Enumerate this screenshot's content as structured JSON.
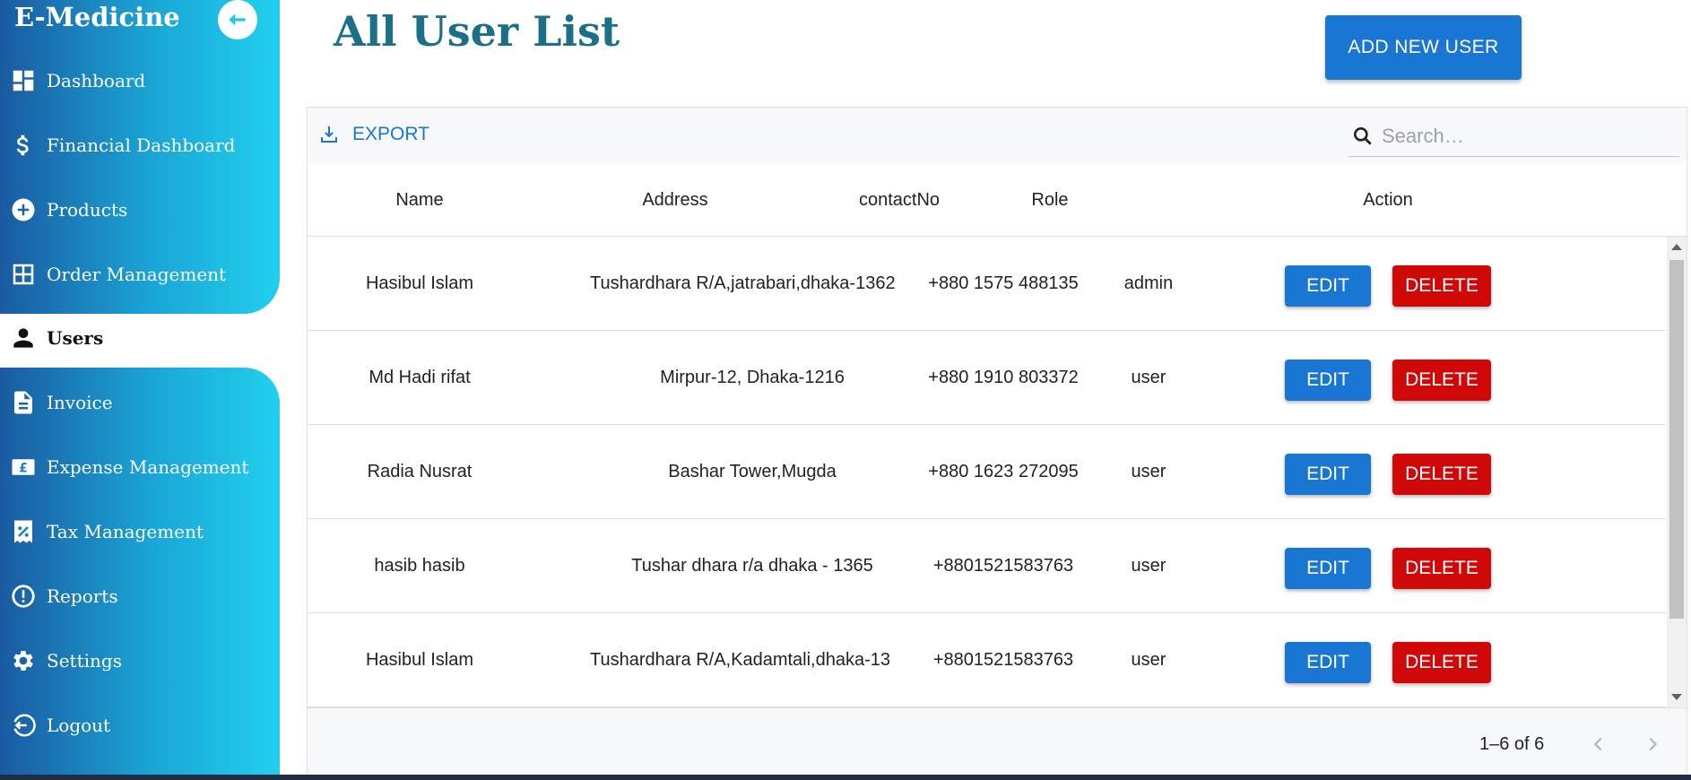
{
  "app": {
    "brand": "E-Medicine"
  },
  "sidebar": {
    "items": [
      {
        "label": "Dashboard",
        "icon": "dashboard-icon"
      },
      {
        "label": "Financial Dashboard",
        "icon": "dollar-icon"
      },
      {
        "label": "Products",
        "icon": "add-circle-icon"
      },
      {
        "label": "Order Management",
        "icon": "grid-icon"
      },
      {
        "label": "Users",
        "icon": "person-icon",
        "active": true
      },
      {
        "label": "Invoice",
        "icon": "document-icon"
      },
      {
        "label": "Expense Management",
        "icon": "pound-icon"
      },
      {
        "label": "Tax Management",
        "icon": "tax-receipt-icon"
      },
      {
        "label": "Reports",
        "icon": "alert-circle-icon"
      },
      {
        "label": "Settings",
        "icon": "gear-icon"
      },
      {
        "label": "Logout",
        "icon": "logout-icon"
      }
    ]
  },
  "main": {
    "title": "All User List",
    "add_button": "ADD NEW USER"
  },
  "grid": {
    "export_label": "EXPORT",
    "search_placeholder": "Search…",
    "columns": [
      "Name",
      "Address",
      "contactNo",
      "Role",
      "Action"
    ],
    "rows": [
      {
        "name": "Hasibul Islam",
        "address": "Tushardhara R/A,jatrabari,dhaka-1362",
        "contact": "+880 1575 488135",
        "role": "admin"
      },
      {
        "name": "Md Hadi rifat",
        "address": "Mirpur-12, Dhaka-1216",
        "contact": "+880 1910 803372",
        "role": "user"
      },
      {
        "name": "Radia Nusrat",
        "address": "Bashar Tower,Mugda",
        "contact": "+880 1623 272095",
        "role": "user"
      },
      {
        "name": "hasib hasib",
        "address": "Tushar dhara r/a dhaka - 1365",
        "contact": "+8801521583763",
        "role": "user"
      },
      {
        "name": "Hasibul Islam",
        "address": "Tushardhara R/A,Kadamtali,dhaka-13",
        "contact": "+8801521583763",
        "role": "user"
      }
    ],
    "edit_label": "EDIT",
    "delete_label": "DELETE",
    "pagination": "1–6 of 6"
  },
  "colors": {
    "primary": "#1976d2",
    "danger": "#d10808",
    "title": "#1b6f86",
    "sidebar_gradient_start": "#1a5aa0",
    "sidebar_gradient_end": "#22d0ee"
  }
}
